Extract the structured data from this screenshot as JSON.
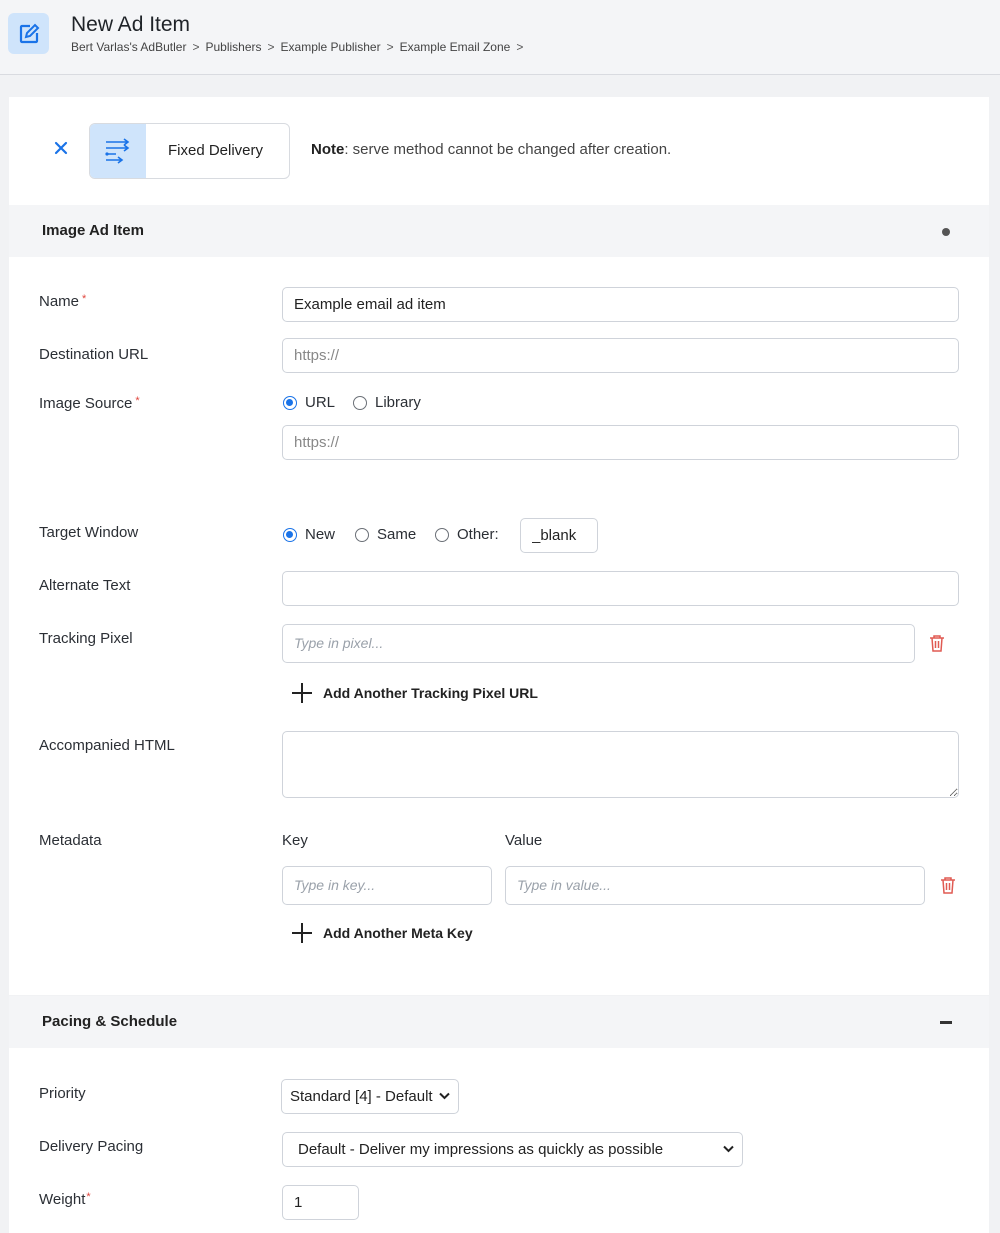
{
  "header": {
    "title": "New Ad Item",
    "breadcrumb": [
      "Bert Varlas's AdButler",
      "Publishers",
      "Example Publisher",
      "Example Email Zone"
    ],
    "separator": ">"
  },
  "serve_method": {
    "label": "Fixed Delivery",
    "note_bold": "Note",
    "note_text": ": serve method cannot be changed after creation."
  },
  "image_section": {
    "title": "Image Ad Item",
    "name_label": "Name",
    "name_value": "Example email ad item",
    "destination_label": "Destination URL",
    "destination_placeholder": "https://",
    "image_source_label": "Image Source",
    "image_source_options": [
      "URL",
      "Library"
    ],
    "image_source_selected": "URL",
    "image_url_placeholder": "https://",
    "target_window_label": "Target Window",
    "target_options": [
      "New",
      "Same",
      "Other:"
    ],
    "target_selected": "New",
    "target_other_value": "_blank",
    "alt_text_label": "Alternate Text",
    "tracking_label": "Tracking Pixel",
    "tracking_placeholder": "Type in pixel...",
    "add_tracking": "Add Another Tracking Pixel URL",
    "html_label": "Accompanied HTML",
    "metadata_label": "Metadata",
    "key_header": "Key",
    "value_header": "Value",
    "key_placeholder": "Type in key...",
    "value_placeholder": "Type in value...",
    "add_meta": "Add Another Meta Key"
  },
  "schedule_section": {
    "title": "Pacing & Schedule",
    "priority_label": "Priority",
    "priority_value": "Standard [4] - Default",
    "pacing_label": "Delivery Pacing",
    "pacing_value": "Default - Deliver my impressions as quickly as possible",
    "weight_label": "Weight",
    "weight_value": "1"
  },
  "colors": {
    "accent": "#1a73e8",
    "icon_bg": "#cfe4fb",
    "required": "#e0453c",
    "trash": "#e05a52"
  }
}
